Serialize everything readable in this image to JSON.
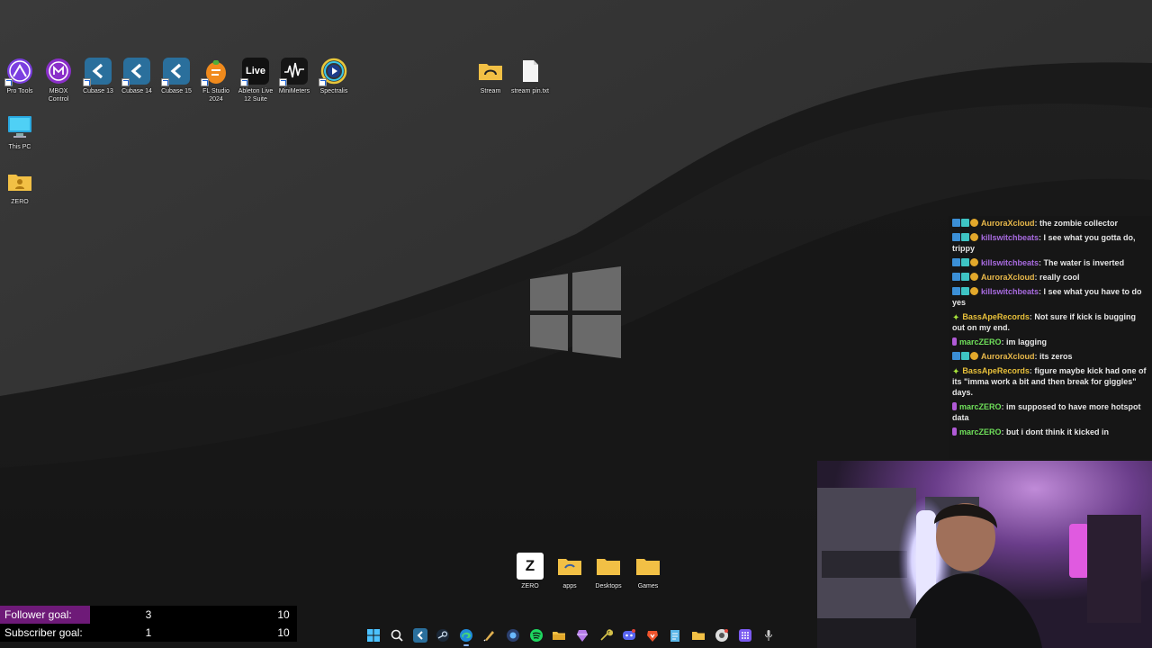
{
  "desktop_icons": [
    {
      "label": "Pro Tools",
      "icon": "pro-tools-icon"
    },
    {
      "label": "MBOX\nControl",
      "icon": "mbox-control-icon"
    },
    {
      "label": "Cubase 13",
      "icon": "cubase-icon"
    },
    {
      "label": "Cubase 14",
      "icon": "cubase-icon"
    },
    {
      "label": "Cubase 15",
      "icon": "cubase-icon"
    },
    {
      "label": "FL Studio\n2024",
      "icon": "fl-studio-icon"
    },
    {
      "label": "Ableton Live\n12 Suite",
      "icon": "ableton-live-icon",
      "icon_text": "Live"
    },
    {
      "label": "MiniMeters",
      "icon": "minimeters-icon"
    },
    {
      "label": "Spectralis",
      "icon": "spectralis-icon"
    },
    {
      "label": "This PC",
      "icon": "this-pc-icon"
    },
    {
      "label": "ZERO",
      "icon": "user-folder-icon"
    },
    {
      "label": "Stream",
      "icon": "folder-icon"
    },
    {
      "label": "stream pin.txt",
      "icon": "text-file-icon"
    },
    {
      "label": "ZERO",
      "icon": "zero-app-icon",
      "icon_text": "Z"
    },
    {
      "label": "apps",
      "icon": "folder-icon"
    },
    {
      "label": "Desktops",
      "icon": "folder-icon"
    },
    {
      "label": "Games",
      "icon": "folder-icon"
    }
  ],
  "chat": {
    "messages": [
      {
        "badges": [
          "blue",
          "teal",
          "gold"
        ],
        "user": "AuroraXcloud",
        "color": "#e8b84a",
        "text": "the zombie collector"
      },
      {
        "badges": [
          "blue",
          "teal",
          "gold"
        ],
        "user": "killswitchbeats",
        "color": "#a86be0",
        "text": "I see what you gotta do, trippy"
      },
      {
        "badges": [
          "blue",
          "teal",
          "gold"
        ],
        "user": "killswitchbeats",
        "color": "#a86be0",
        "text": "The water is inverted"
      },
      {
        "badges": [
          "blue",
          "teal",
          "gold"
        ],
        "user": "AuroraXcloud",
        "color": "#e8b84a",
        "text": "really cool"
      },
      {
        "badges": [
          "blue",
          "teal",
          "gold"
        ],
        "user": "killswitchbeats",
        "color": "#a86be0",
        "text": "I see what you have to do yes"
      },
      {
        "badges": [
          "green"
        ],
        "user": "BassApeRecords",
        "color": "#e8c03a",
        "text": "Not sure if kick is bugging out on my end."
      },
      {
        "badges": [
          "purple"
        ],
        "user": "marcZERO",
        "color": "#6fe05a",
        "text": "im lagging"
      },
      {
        "badges": [
          "blue",
          "teal",
          "gold"
        ],
        "user": "AuroraXcloud",
        "color": "#e8b84a",
        "text": "its zeros"
      },
      {
        "badges": [
          "green"
        ],
        "user": "BassApeRecords",
        "color": "#e8c03a",
        "text": "figure maybe kick had one of its \"imma work a bit and then break for giggles\" days."
      },
      {
        "badges": [
          "purple"
        ],
        "user": "marcZERO",
        "color": "#6fe05a",
        "text": "im supposed to have more hotspot data"
      },
      {
        "badges": [
          "purple"
        ],
        "user": "marcZERO",
        "color": "#6fe05a",
        "text": "but i dont think it kicked in"
      }
    ]
  },
  "goals": {
    "follower": {
      "label": "Follower goal:",
      "current": "3",
      "target": "10",
      "progress": 0.3
    },
    "subscriber": {
      "label": "Subscriber goal:",
      "current": "1",
      "target": "10",
      "progress": 0.1
    }
  },
  "taskbar": {
    "items": [
      {
        "name": "start-icon",
        "active": false
      },
      {
        "name": "search-icon",
        "active": false
      },
      {
        "name": "cubase-icon",
        "active": false
      },
      {
        "name": "steam-icon",
        "active": false
      },
      {
        "name": "edge-icon",
        "active": true
      },
      {
        "name": "pen-tool-icon",
        "active": false
      },
      {
        "name": "app-shield-icon",
        "active": false
      },
      {
        "name": "spotify-icon",
        "active": false
      },
      {
        "name": "file-explorer-icon",
        "active": false
      },
      {
        "name": "gem-icon",
        "active": false
      },
      {
        "name": "tool-icon",
        "active": false
      },
      {
        "name": "discord-icon",
        "active": false
      },
      {
        "name": "brave-icon",
        "active": false
      },
      {
        "name": "notepad-icon",
        "active": false
      },
      {
        "name": "folder-icon",
        "active": false
      },
      {
        "name": "chrome-icon",
        "active": false
      },
      {
        "name": "grid-app-icon",
        "active": false
      },
      {
        "name": "mic-icon",
        "active": false
      }
    ]
  },
  "colors": {
    "goal_bar": "#6e1a78",
    "accent": "#1e63d4"
  }
}
